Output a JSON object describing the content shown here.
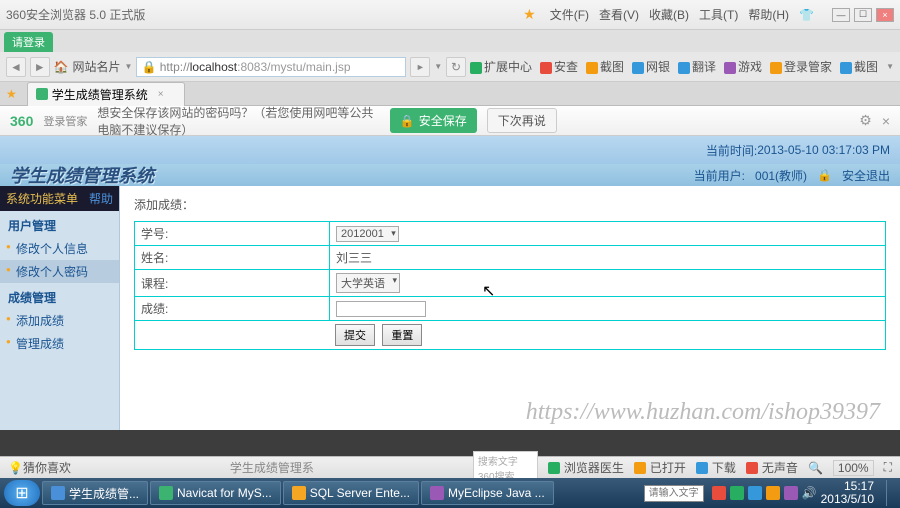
{
  "browser": {
    "title": "360安全浏览器 5.0 正式版",
    "menus": {
      "file": "文件(F)",
      "view": "查看(V)",
      "fav": "收藏(B)",
      "tool": "工具(T)",
      "help": "帮助(H)"
    },
    "badge": "请登录",
    "addr_label": "网站名片",
    "url_host": "localhost",
    "url_port": ":8083",
    "url_path": "/mystu/main.jsp",
    "ext": {
      "center": "扩展中心",
      "safe": "安查",
      "intercept": "截图",
      "net": "网银",
      "trans": "翻译",
      "game": "游戏",
      "login": "登录管家",
      "shot": "截图"
    }
  },
  "tab": {
    "title": "学生成绩管理系统"
  },
  "pwdbar": {
    "logo": "360",
    "logosub": "登录管家",
    "text": "想安全保存该网站的密码吗？（若您使用网吧等公共电脑不建议保存）",
    "save": "安全保存",
    "later": "下次再说"
  },
  "header": {
    "time_label": "当前时间:",
    "time_value": "2013-05-10 03:17:03 PM",
    "title": "学生成绩管理系统",
    "user_label": "当前用户:",
    "user_value": "001(教师)",
    "logout": "安全退出"
  },
  "sidebar": {
    "top1": "系统功能菜单",
    "top2": "帮助",
    "sec1": "用户管理",
    "items1": [
      "修改个人信息",
      "修改个人密码"
    ],
    "sec2": "成绩管理",
    "items2": [
      "添加成绩",
      "管理成绩"
    ]
  },
  "form": {
    "title": "添加成绩：",
    "rows": {
      "sid": {
        "label": "学号:",
        "value": "2012001"
      },
      "name": {
        "label": "姓名:",
        "value": "刘三三"
      },
      "course": {
        "label": "课程:",
        "value": "大学英语"
      },
      "score": {
        "label": "成绩:",
        "value": ""
      }
    },
    "submit": "提交",
    "reset": "重置"
  },
  "watermark": "https://www.huzhan.com/ishop39397",
  "status": {
    "center_text": "学生成绩管理系",
    "tips": "猜你喜欢",
    "search": "搜索文字360搜索",
    "doctor": "浏览器医生",
    "open": "已打开",
    "download": "下载",
    "mute": "无声音",
    "zoom": "100%"
  },
  "taskbar": {
    "items": [
      "学生成绩管...",
      "Navicat for MyS...",
      "SQL Server Ente...",
      "MyEclipse Java ..."
    ],
    "input_ph": "请输入文字",
    "clock_time": "15:17",
    "clock_date": "2013/5/10"
  }
}
